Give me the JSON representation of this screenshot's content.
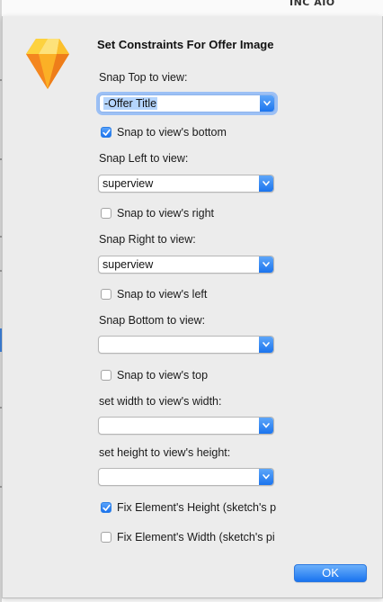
{
  "background": {
    "partial_text": "INC AIO"
  },
  "dialog": {
    "title": "Set Constraints For Offer Image",
    "app_icon": "sketch-diamond-icon",
    "snap_top": {
      "label": "Snap Top to view:",
      "value": "-Offer Title",
      "checkbox_label": "Snap to view's bottom",
      "checkbox_checked": true
    },
    "snap_left": {
      "label": "Snap Left to view:",
      "value": "superview",
      "checkbox_label": "Snap to view's right",
      "checkbox_checked": false
    },
    "snap_right": {
      "label": "Snap Right to view:",
      "value": "superview",
      "checkbox_label": "Snap to view's left",
      "checkbox_checked": false
    },
    "snap_bottom": {
      "label": "Snap Bottom to view:",
      "value": "",
      "checkbox_label": "Snap to view's top",
      "checkbox_checked": false
    },
    "width": {
      "label": "set width to view's width:",
      "value": ""
    },
    "height": {
      "label": "set height to view's height:",
      "value": ""
    },
    "fix_height": {
      "label": "Fix Element's Height (sketch's p",
      "checked": true
    },
    "fix_width": {
      "label": "Fix Element's Width (sketch's pi",
      "checked": false
    },
    "ok_label": "OK"
  },
  "colors": {
    "accent": "#1a74ef",
    "sheet_background": "#ececec",
    "focus_ring": "#9cc0f5",
    "selection": "#b5d5fd"
  }
}
